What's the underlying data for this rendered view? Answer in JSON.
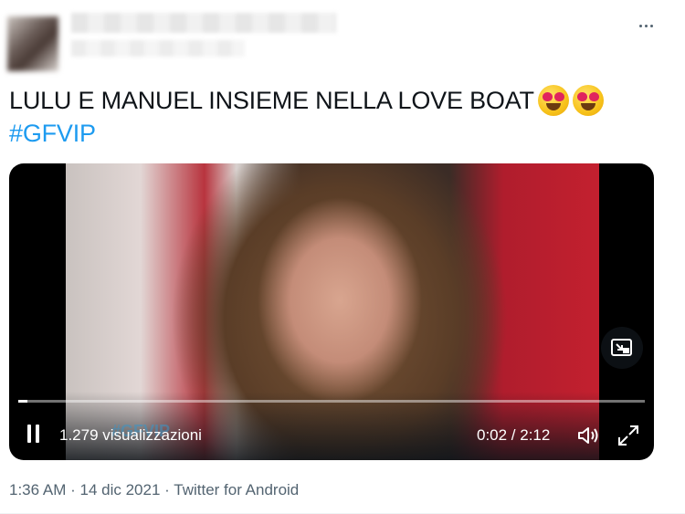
{
  "tweet": {
    "text_line1": "LULU E MANUEL INSIEME NELLA LOVE BOAT",
    "emojis": [
      "heart-eyes-emoji",
      "heart-eyes-emoji"
    ],
    "hashtag": "#GFVIP"
  },
  "video": {
    "watermark": "#GFVIP",
    "views": "1.279 visualizzazioni",
    "time": "0:02 / 2:12",
    "progress": 0.015
  },
  "meta": {
    "time": "1:36 AM",
    "separator": "·",
    "date": "14 dic 2021",
    "source": "Twitter for Android"
  },
  "icons": {
    "more": "more-horizontal-icon",
    "pip": "picture-in-picture-icon",
    "pause": "pause-icon",
    "volume": "volume-icon",
    "fullscreen": "fullscreen-icon"
  },
  "colors": {
    "accent": "#1d9bf0",
    "text": "#0f1419",
    "secondary": "#536471"
  }
}
